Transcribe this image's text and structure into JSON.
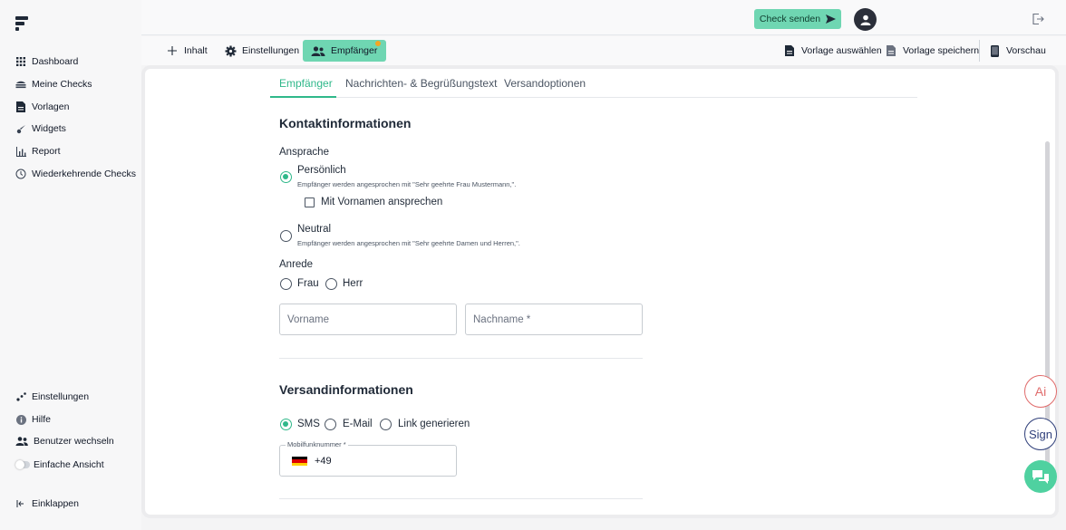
{
  "sidebar": {
    "items": [
      {
        "label": "Dashboard",
        "icon": "grid-icon"
      },
      {
        "label": "Meine Checks",
        "icon": "stack-icon"
      },
      {
        "label": "Vorlagen",
        "icon": "document-icon"
      },
      {
        "label": "Widgets",
        "icon": "brush-icon"
      },
      {
        "label": "Report",
        "icon": "bar-chart-icon"
      },
      {
        "label": "Wiederkehrende Checks",
        "icon": "clock-icon"
      }
    ],
    "bottom_items": [
      {
        "label": "Einstellungen",
        "icon": "settings-dots-icon"
      },
      {
        "label": "Hilfe",
        "icon": "info-icon"
      },
      {
        "label": "Benutzer wechseln",
        "icon": "users-icon"
      },
      {
        "label": "Einfache Ansicht",
        "icon": "toggle-icon"
      },
      {
        "label": "Einklappen",
        "icon": "collapse-arrow-icon"
      }
    ]
  },
  "header": {
    "check_send_label": "Check senden"
  },
  "tabs": {
    "inhalt": "Inhalt",
    "einstellungen": "Einstellungen",
    "empfaenger": "Empfänger",
    "vorlage_auswaehlen": "Vorlage auswählen",
    "vorlage_speichern": "Vorlage speichern",
    "vorschau": "Vorschau"
  },
  "subtabs": [
    "Empfänger",
    "Nachrichten- & Begrüßungstext",
    "Versandoptionen"
  ],
  "contact": {
    "title": "Kontaktinformationen",
    "ansprache_label": "Ansprache",
    "persoenlich_label": "Persönlich",
    "persoenlich_help": "Empfänger werden angesprochen mit \"Sehr geehrte Frau Mustermann,\".",
    "vorname_checkbox": "Mit Vornamen ansprechen",
    "neutral_label": "Neutral",
    "neutral_help": "Empfänger werden angesprochen mit \"Sehr geehrte Damen und Herren,\".",
    "anrede_label": "Anrede",
    "frau": "Frau",
    "herr": "Herr",
    "vorname_placeholder": "Vorname",
    "nachname_placeholder": "Nachname *"
  },
  "shipping": {
    "title": "Versandinformationen",
    "sms": "SMS",
    "email": "E-Mail",
    "link": "Link generieren",
    "mobile_label": "Mobilfunknummer *",
    "mobile_prefix": "+49"
  },
  "fabs": {
    "ai": "Ai",
    "sign": "Sign"
  },
  "colors": {
    "accent": "#6fd6b2",
    "accent_text": "#2fb88a",
    "notification_dot": "#f5a623"
  }
}
